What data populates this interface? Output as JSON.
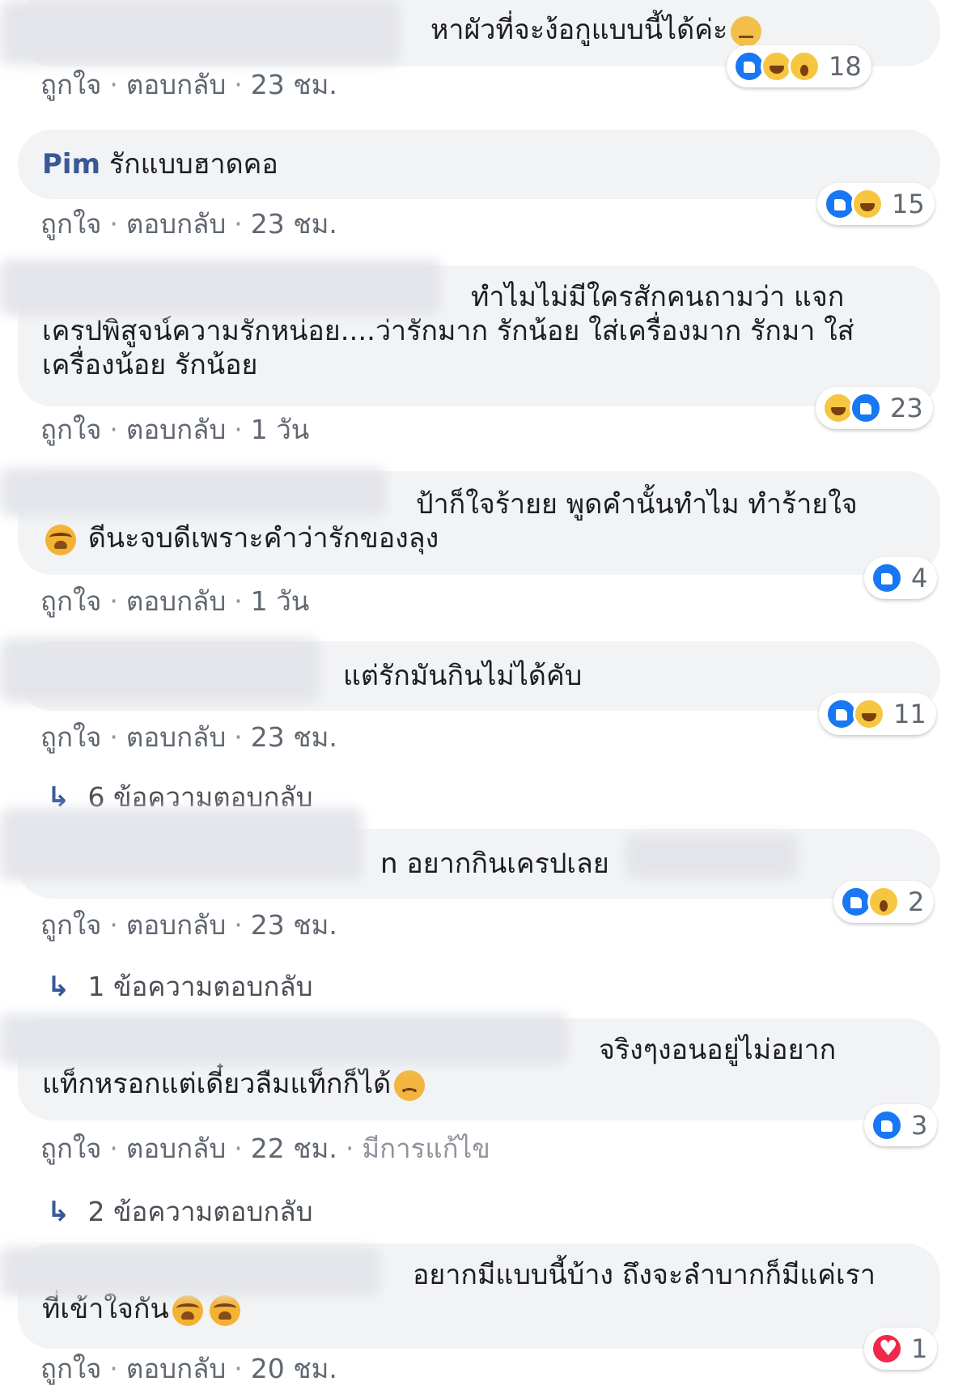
{
  "action_labels": {
    "like": "ถูกใจ",
    "reply": "ตอบกลับ",
    "separator": "·"
  },
  "comments": [
    {
      "author": "",
      "text_first": "หาผัวที่จะง้อกูแบบนี้ได้ค่ะ",
      "text_rest": "",
      "time": "23 ชม.",
      "edited": "",
      "reactions": {
        "types": [
          "like",
          "haha",
          "wow"
        ],
        "count": "18"
      },
      "replies": ""
    },
    {
      "author": "Pim",
      "text_first": "รักแบบฮาดคอ",
      "text_rest": "",
      "time": "23 ชม.",
      "edited": "",
      "reactions": {
        "types": [
          "like",
          "haha"
        ],
        "count": "15"
      },
      "replies": ""
    },
    {
      "author": "",
      "text_first": "ทำไมไม่มีใครสักคนถามว่า แจก",
      "text_rest": "เครปพิสูจน์ความรักหน่อย....ว่ารักมาก รักน้อย ใส่เครื่องมาก รักมา ใส่เครื่องน้อย รักน้อย",
      "time": "1 วัน",
      "edited": "",
      "reactions": {
        "types": [
          "haha",
          "like"
        ],
        "count": "23"
      },
      "replies": ""
    },
    {
      "author": "",
      "text_first": "ป้าก็ใจร้ายย พูดคำนั้นทำไม ทำร้ายใจ",
      "text_rest": "ดีนะจบดีเพราะคำว่ารักของลุง",
      "time": "1 วัน",
      "edited": "",
      "reactions": {
        "types": [
          "like"
        ],
        "count": "4"
      },
      "replies": ""
    },
    {
      "author": "",
      "text_first": "แต่รักมันกินไม่ได้คับ",
      "text_rest": "",
      "time": "23 ชม.",
      "edited": "",
      "reactions": {
        "types": [
          "like",
          "haha"
        ],
        "count": "11"
      },
      "replies": "6 ข้อความตอบกลับ"
    },
    {
      "author": "",
      "text_first": "n อยากกินเครปเลย",
      "text_rest": "",
      "time": "23 ชม.",
      "edited": "",
      "reactions": {
        "types": [
          "like",
          "wow"
        ],
        "count": "2"
      },
      "replies": "1 ข้อความตอบกลับ"
    },
    {
      "author": "",
      "text_first": "จริงๆงอนอยู่ไม่อยาก",
      "text_rest": "แท็กหรอกแต่เดี๋ยวลืมแท็กก็ได้",
      "time": "22 ชม.",
      "edited": "มีการแก้ไข",
      "reactions": {
        "types": [
          "like"
        ],
        "count": "3"
      },
      "replies": "2 ข้อความตอบกลับ"
    },
    {
      "author": "",
      "text_first": "อยากมีแบบนี้บ้าง ถึงจะลำบากก็มีแค่เรา",
      "text_rest": "ที่เข้าใจกัน",
      "time": "20 ชม.",
      "edited": "",
      "reactions": {
        "types": [
          "love"
        ],
        "count": "1"
      },
      "replies": ""
    }
  ],
  "emoji_names": [
    "roll-eyes-emoji",
    "crying-emoji",
    "sad-emoji"
  ]
}
